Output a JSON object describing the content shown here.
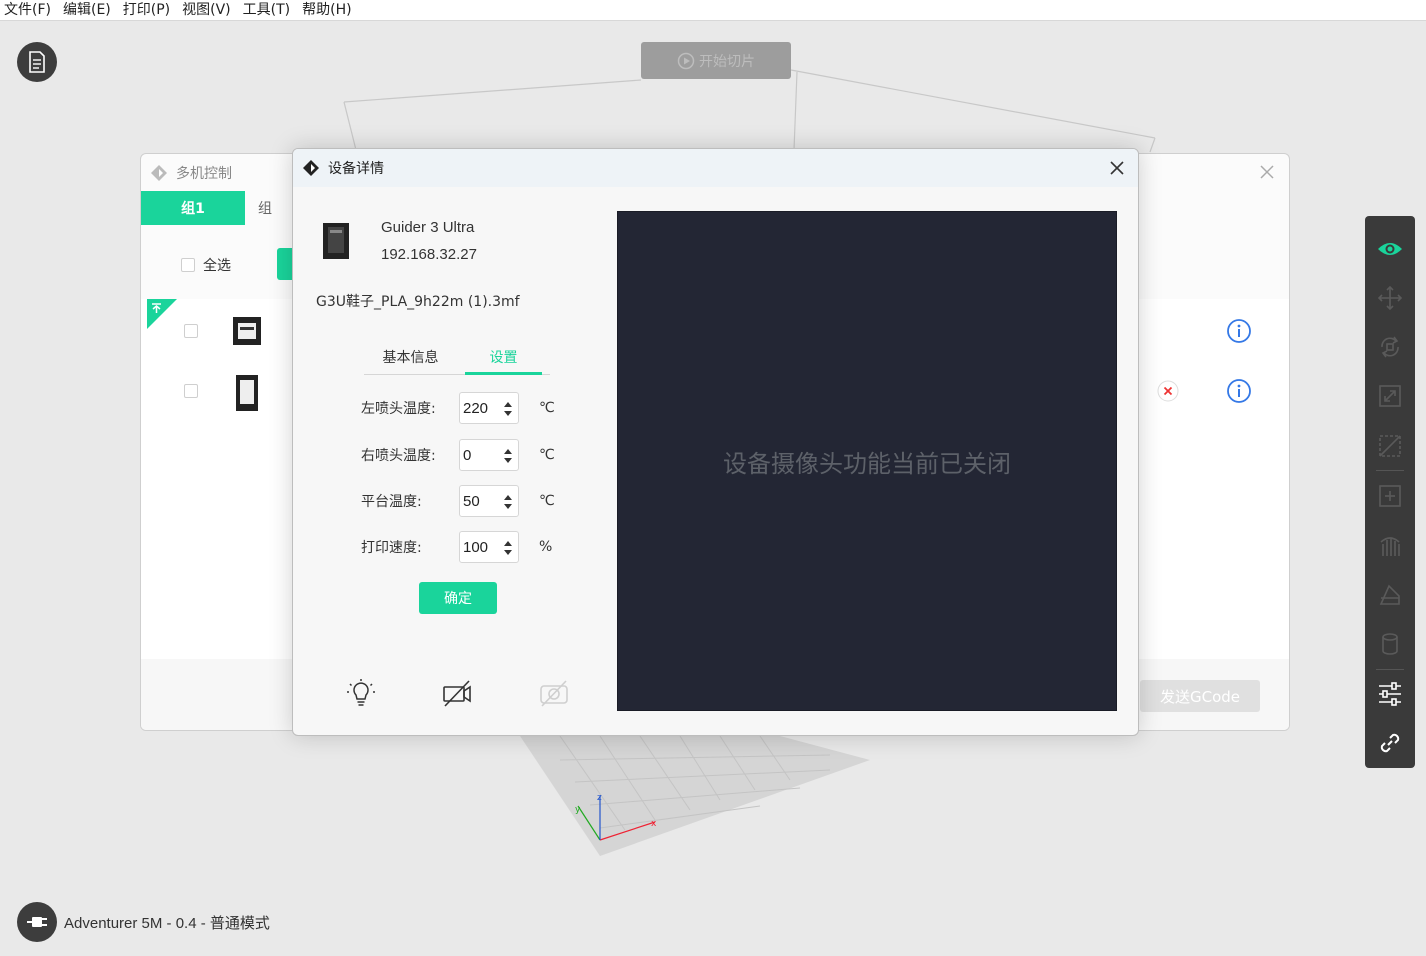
{
  "menu": [
    "文件(F)",
    "编辑(E)",
    "打印(P)",
    "视图(V)",
    "工具(T)",
    "帮助(H)"
  ],
  "slice_button": "开始切片",
  "machine_status": "Adventurer 5M - 0.4 - 普通模式",
  "multi_control": {
    "title": "多机控制",
    "tabs": [
      "组1",
      "组"
    ],
    "select_all": "全选",
    "send_gcode": "发送GCode"
  },
  "device_dialog": {
    "title": "设备详情",
    "device_name": "Guider 3 Ultra",
    "device_ip": "192.168.32.27",
    "file_name": "G3U鞋子_PLA_9h22m (1).3mf",
    "tabs": [
      "基本信息",
      "设置"
    ],
    "active_tab": "设置",
    "fields": [
      {
        "label": "左喷头温度:",
        "value": "220",
        "unit": "℃"
      },
      {
        "label": "右喷头温度:",
        "value": "0",
        "unit": "℃"
      },
      {
        "label": "平台温度:",
        "value": "50",
        "unit": "℃"
      },
      {
        "label": "打印速度:",
        "value": "100",
        "unit": "%"
      }
    ],
    "confirm": "确定",
    "camera_message": "设备摄像头功能当前已关闭",
    "bottom_icons": [
      "light-bulb-icon",
      "camera-off-icon",
      "camera-off-disabled-icon"
    ]
  },
  "colors": {
    "accent": "#1ad49b",
    "camera_bg": "#232634",
    "toolbar_bg": "#3a3a3a"
  }
}
